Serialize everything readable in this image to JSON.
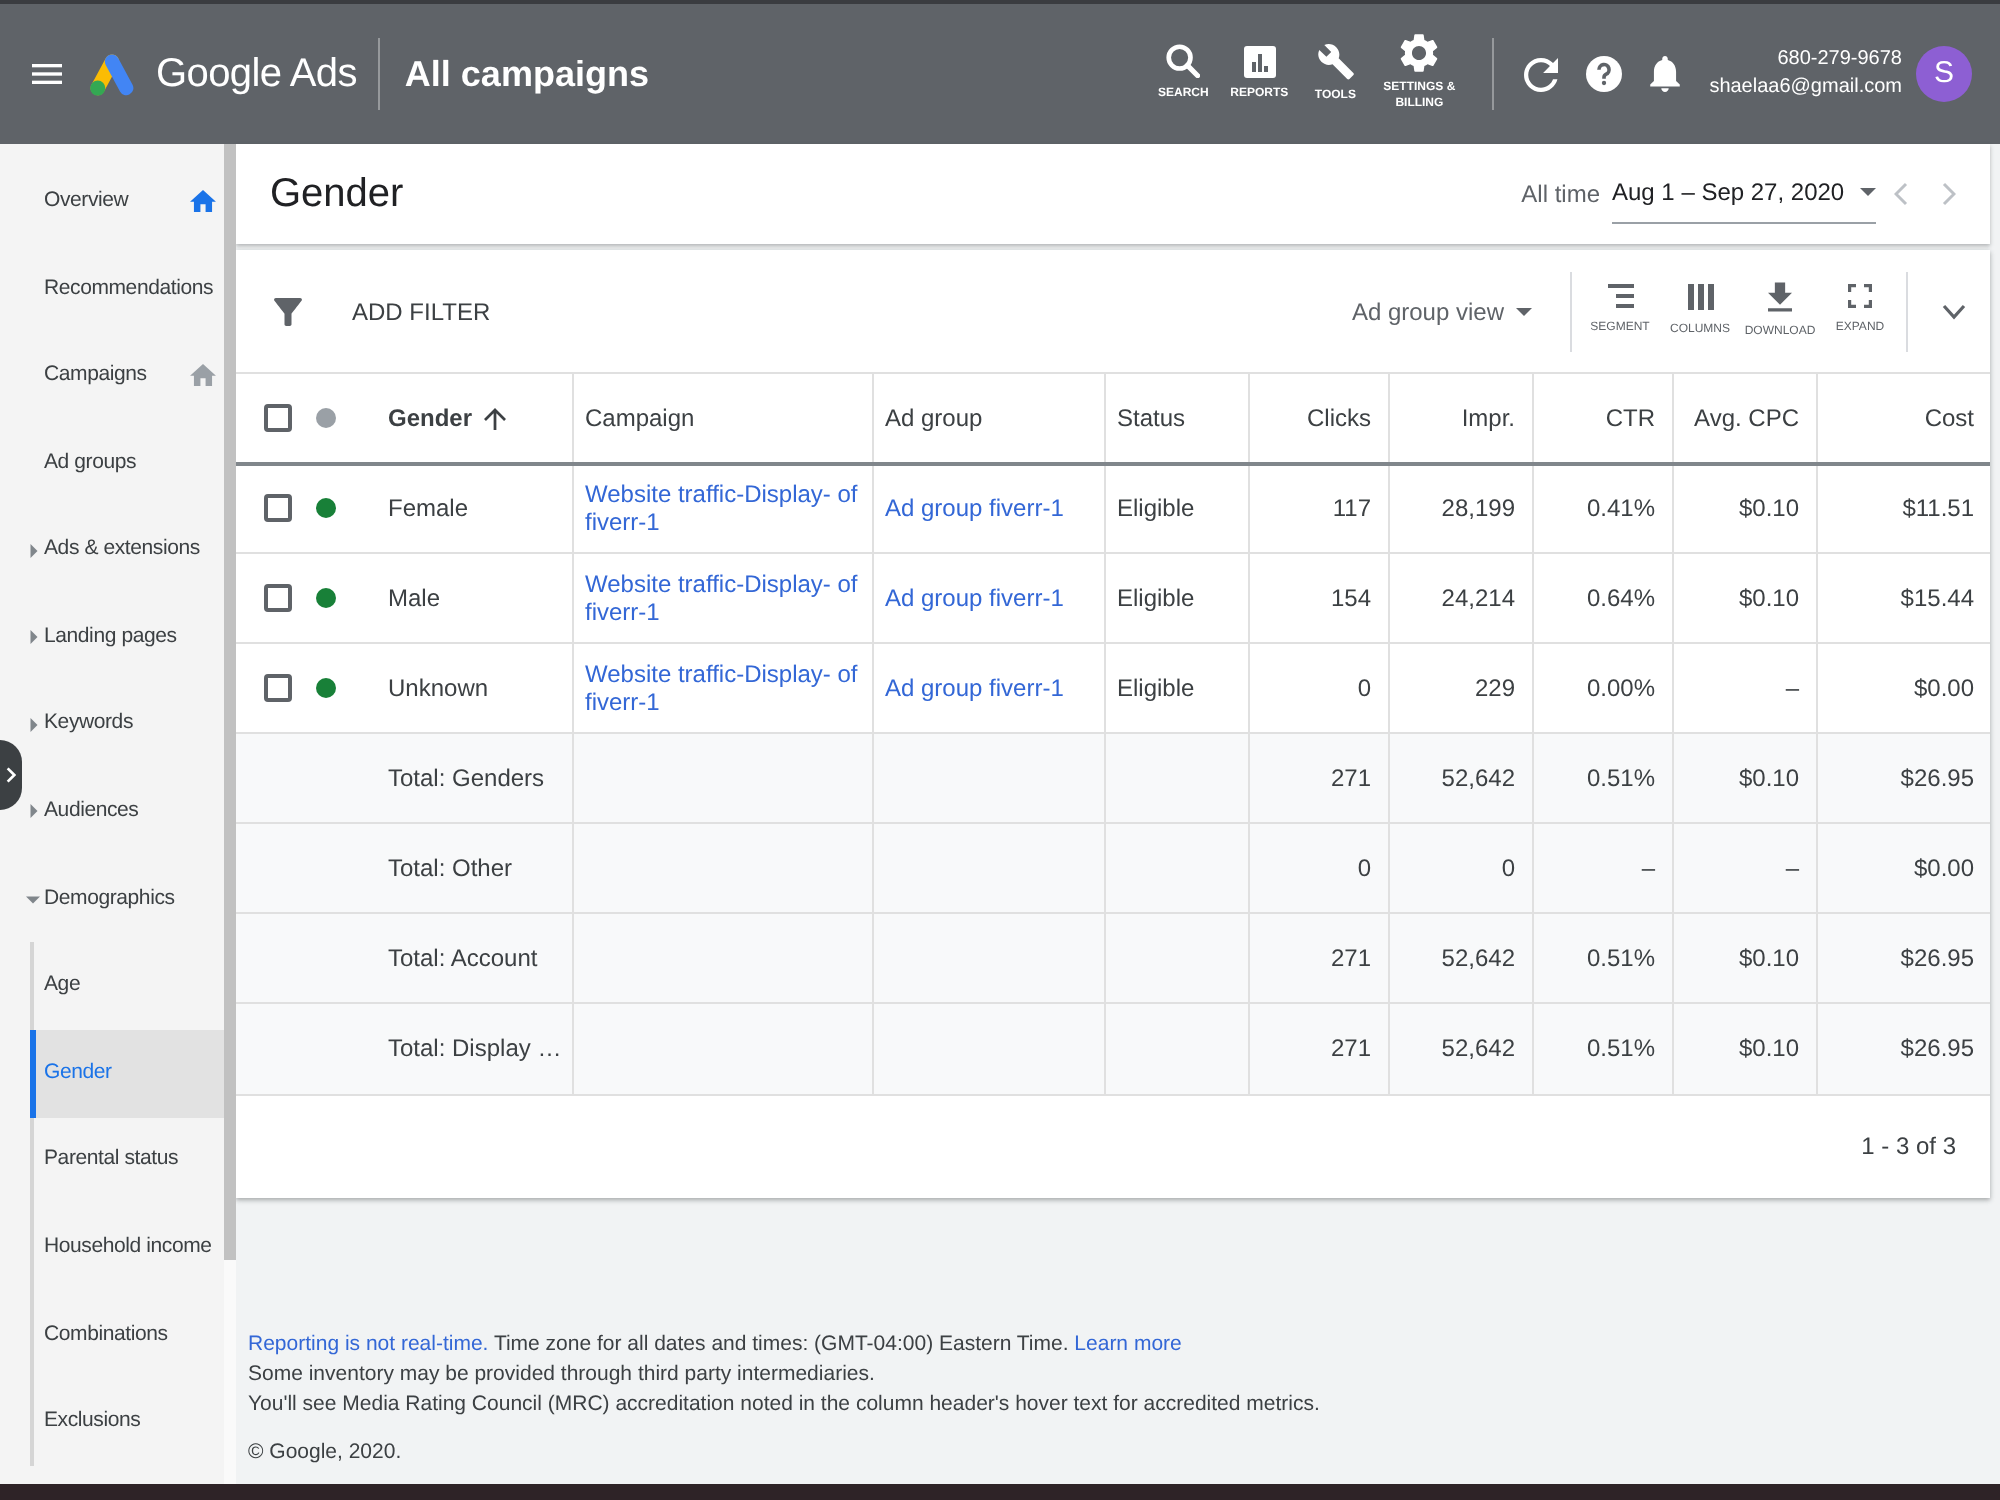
{
  "top_bar": {
    "product": "Google Ads",
    "page_title": "All campaigns",
    "tools": [
      {
        "kind": "search",
        "label": "SEARCH"
      },
      {
        "kind": "reports",
        "label": "REPORTS"
      },
      {
        "kind": "tools",
        "label": "TOOLS"
      },
      {
        "kind": "settings",
        "label": "SETTINGS & BILLING"
      }
    ],
    "account": {
      "phone": "680-279-9678",
      "email": "shaelaa6@gmail.com",
      "avatar_letter": "S"
    }
  },
  "sidebar": {
    "items": [
      {
        "label": "Overview",
        "selected": false,
        "home_page": true
      },
      {
        "label": "Recommendations",
        "selected": false
      },
      {
        "label": "Campaigns",
        "selected": false,
        "home_page": false
      },
      {
        "label": "Ad groups",
        "selected": false
      },
      {
        "label": "Ads & extensions",
        "selected": false,
        "expanded": false
      },
      {
        "label": "Landing pages",
        "selected": false,
        "expanded": false
      },
      {
        "label": "Keywords",
        "selected": false,
        "expanded": false
      },
      {
        "label": "Audiences",
        "selected": false,
        "expanded": false
      },
      {
        "label": "Demographics",
        "selected": false,
        "expanded": true,
        "children": [
          {
            "label": "Age",
            "selected": false
          },
          {
            "label": "Gender",
            "selected": true
          },
          {
            "label": "Parental status",
            "selected": false
          },
          {
            "label": "Household income",
            "selected": false
          },
          {
            "label": "Combinations",
            "selected": false
          },
          {
            "label": "Exclusions",
            "selected": false
          }
        ]
      }
    ]
  },
  "page": {
    "title": "Gender",
    "date_range": {
      "preset": "All time",
      "range": "Aug 1 – Sep 27, 2020",
      "previous_disabled": true,
      "next_disabled": true
    }
  },
  "toolbar": {
    "add_filter": "ADD FILTER",
    "view": "Ad group view",
    "actions": [
      {
        "kind": "segment",
        "label": "SEGMENT"
      },
      {
        "kind": "columns",
        "label": "COLUMNS"
      },
      {
        "kind": "download",
        "label": "DOWNLOAD"
      },
      {
        "kind": "expand",
        "label": "EXPAND"
      }
    ]
  },
  "table": {
    "select_all_checked": false,
    "columns": [
      {
        "label": "Gender",
        "kind": "text",
        "sorted": true
      },
      {
        "label": "Campaign",
        "kind": "link",
        "sorted": false
      },
      {
        "label": "Ad group",
        "kind": "link",
        "sorted": false
      },
      {
        "label": "Status",
        "kind": "text",
        "sorted": false
      },
      {
        "label": "Clicks",
        "kind": "metric",
        "sorted": false
      },
      {
        "label": "Impr.",
        "kind": "metric",
        "sorted": false
      },
      {
        "label": "CTR",
        "kind": "metric",
        "sorted": false
      },
      {
        "label": "Avg. CPC",
        "kind": "metric",
        "sorted": false
      },
      {
        "label": "Cost",
        "kind": "metric",
        "sorted": false
      }
    ],
    "rows": [
      {
        "checked": false,
        "enabled": true,
        "cells": [
          "Female",
          "Website traffic-Display- of fiverr-1",
          "Ad group fiverr-1",
          "Eligible",
          "117",
          "28,199",
          "0.41%",
          "$0.10",
          "$11.51"
        ]
      },
      {
        "checked": false,
        "enabled": true,
        "cells": [
          "Male",
          "Website traffic-Display- of fiverr-1",
          "Ad group fiverr-1",
          "Eligible",
          "154",
          "24,214",
          "0.64%",
          "$0.10",
          "$15.44"
        ]
      },
      {
        "checked": false,
        "enabled": true,
        "cells": [
          "Unknown",
          "Website traffic-Display- of fiverr-1",
          "Ad group fiverr-1",
          "Eligible",
          "0",
          "229",
          "0.00%",
          "–",
          "$0.00"
        ]
      }
    ],
    "totals": [
      {
        "label": "Total: Genders",
        "values": [
          "271",
          "52,642",
          "0.51%",
          "$0.10",
          "$26.95"
        ]
      },
      {
        "label": "Total: Other",
        "values": [
          "0",
          "0",
          "–",
          "–",
          "$0.00"
        ]
      },
      {
        "label": "Total: Account",
        "values": [
          "271",
          "52,642",
          "0.51%",
          "$0.10",
          "$26.95"
        ]
      },
      {
        "label": "Total: Display …",
        "values": [
          "271",
          "52,642",
          "0.51%",
          "$0.10",
          "$26.95"
        ]
      }
    ],
    "pagination": "1 - 3 of 3"
  },
  "footer": {
    "realtime_link": "Reporting is not real-time.",
    "timezone_note": "Time zone for all dates and times: (GMT-04:00) Eastern Time.",
    "learn_more_link": "Learn more",
    "inventory_note": "Some inventory may be provided through third party intermediaries.",
    "mrc_note": "You'll see Media Rating Council (MRC) accreditation noted in the column header's hover text for accredited metrics.",
    "copyright": "© Google, 2020."
  }
}
